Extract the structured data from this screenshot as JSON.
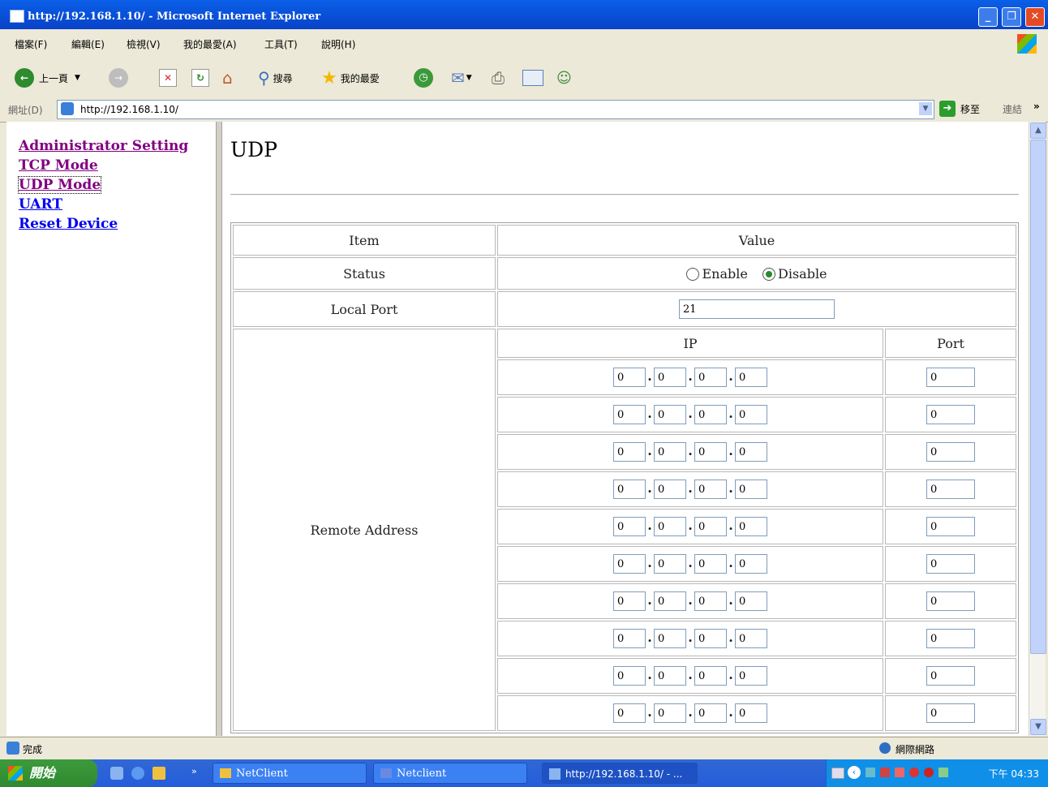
{
  "window": {
    "title": "http://192.168.1.10/ - Microsoft Internet Explorer"
  },
  "menu": [
    "檔案(F)",
    "編輯(E)",
    "檢視(V)",
    "我的最愛(A)",
    "工具(T)",
    "說明(H)"
  ],
  "toolbar": {
    "back": "上一頁",
    "search": "搜尋",
    "favorites": "我的最愛"
  },
  "address": {
    "label": "網址(D)",
    "url": "http://192.168.1.10/",
    "go": "移至",
    "links": "連結"
  },
  "nav": {
    "items": [
      {
        "label": "Administrator Setting",
        "color": "#800080"
      },
      {
        "label": "TCP Mode",
        "color": "#800080"
      },
      {
        "label": "UDP Mode",
        "color": "#800080"
      },
      {
        "label": "UART",
        "color": "#0000EE"
      },
      {
        "label": "Reset Device",
        "color": "#0000EE"
      }
    ]
  },
  "page": {
    "title": "UDP"
  },
  "table": {
    "header_item": "Item",
    "header_value": "Value",
    "status_label": "Status",
    "enable_label": "Enable",
    "disable_label": "Disable",
    "status_selected": "Disable",
    "local_port_label": "Local Port",
    "local_port_value": "21",
    "remote_label": "Remote Address",
    "ip_header": "IP",
    "port_header": "Port",
    "remote_rows": [
      {
        "ip": [
          "0",
          "0",
          "0",
          "0"
        ],
        "port": "0"
      },
      {
        "ip": [
          "0",
          "0",
          "0",
          "0"
        ],
        "port": "0"
      },
      {
        "ip": [
          "0",
          "0",
          "0",
          "0"
        ],
        "port": "0"
      },
      {
        "ip": [
          "0",
          "0",
          "0",
          "0"
        ],
        "port": "0"
      },
      {
        "ip": [
          "0",
          "0",
          "0",
          "0"
        ],
        "port": "0"
      },
      {
        "ip": [
          "0",
          "0",
          "0",
          "0"
        ],
        "port": "0"
      },
      {
        "ip": [
          "0",
          "0",
          "0",
          "0"
        ],
        "port": "0"
      },
      {
        "ip": [
          "0",
          "0",
          "0",
          "0"
        ],
        "port": "0"
      },
      {
        "ip": [
          "0",
          "0",
          "0",
          "0"
        ],
        "port": "0"
      },
      {
        "ip": [
          "0",
          "0",
          "0",
          "0"
        ],
        "port": "0"
      }
    ]
  },
  "status": {
    "text": "完成",
    "zone": "網際網路"
  },
  "taskbar": {
    "start": "開始",
    "tasks": [
      "NetClient",
      "Netclient",
      "http://192.168.1.10/ - ..."
    ],
    "clock": "下午 04:33"
  }
}
